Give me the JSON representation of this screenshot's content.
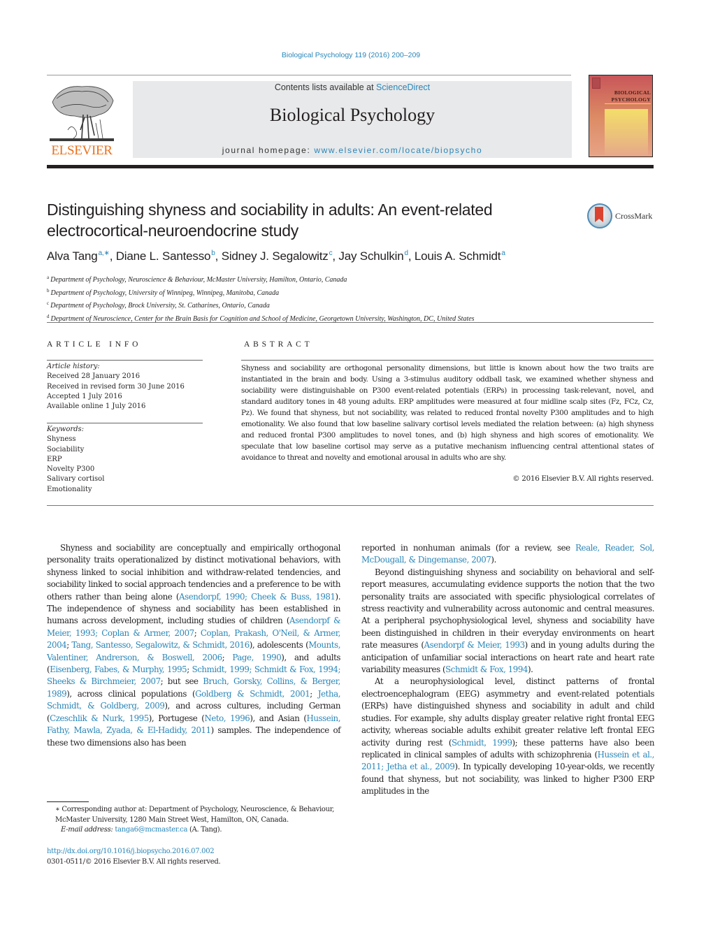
{
  "header": {
    "citation": "Biological Psychology 119 (2016) 200–209",
    "publisher": "ELSEVIER",
    "contents_prefix": "Contents lists available at ",
    "contents_link": "ScienceDirect",
    "journal_name": "Biological Psychology",
    "homepage_prefix": "journal homepage: ",
    "homepage_link": "www.elsevier.com/locate/biopsycho",
    "cover_title_line1": "BIOLOGICAL",
    "cover_title_line2": "PSYCHOLOGY",
    "colors": {
      "link": "#2a86b8",
      "elsevier_orange": "#e9711c",
      "masthead_bg": "#e8e9ea"
    }
  },
  "article": {
    "title": "Distinguishing shyness and sociability in adults: An event-related electrocortical-neuroendocrine study",
    "crossmark_label": "CrossMark",
    "authors": [
      {
        "name": "Alva Tang",
        "sup": "a,∗"
      },
      {
        "name": "Diane L. Santesso",
        "sup": "b"
      },
      {
        "name": "Sidney J. Segalowitz",
        "sup": "c"
      },
      {
        "name": "Jay Schulkin",
        "sup": "d"
      },
      {
        "name": "Louis A. Schmidt",
        "sup": "a"
      }
    ],
    "affiliations": [
      {
        "key": "a",
        "text": "Department of Psychology, Neuroscience & Behaviour, McMaster University, Hamilton, Ontario, Canada"
      },
      {
        "key": "b",
        "text": "Department of Psychology, University of Winnipeg, Winnipeg, Manitoba, Canada"
      },
      {
        "key": "c",
        "text": "Department of Psychology, Brock University, St. Catharines, Ontario, Canada"
      },
      {
        "key": "d",
        "text": "Department of Neuroscience, Center for the Brain Basis for Cognition and School of Medicine, Georgetown University, Washington, DC, United States"
      }
    ]
  },
  "article_info": {
    "heading": "ARTICLE INFO",
    "history_label": "Article history:",
    "history": [
      "Received 28 January 2016",
      "Received in revised form 30 June 2016",
      "Accepted 1 July 2016",
      "Available online 1 July 2016"
    ],
    "keywords_label": "Keywords:",
    "keywords": [
      "Shyness",
      "Sociability",
      "ERP",
      "Novelty P300",
      "Salivary cortisol",
      "Emotionality"
    ]
  },
  "abstract": {
    "heading": "ABSTRACT",
    "text": "Shyness and sociability are orthogonal personality dimensions, but little is known about how the two traits are instantiated in the brain and body. Using a 3-stimulus auditory oddball task, we examined whether shyness and sociability were distinguishable on P300 event-related potentials (ERPs) in processing task-relevant, novel, and standard auditory tones in 48 young adults. ERP amplitudes were measured at four midline scalp sites (Fz, FCz, Cz, Pz). We found that shyness, but not sociability, was related to reduced frontal novelty P300 amplitudes and to high emotionality. We also found that low baseline salivary cortisol levels mediated the relation between: (a) high shyness and reduced frontal P300 amplitudes to novel tones, and (b) high shyness and high scores of emotionality. We speculate that low baseline cortisol may serve as a putative mechanism influencing central attentional states of avoidance to threat and novelty and emotional arousal in adults who are shy.",
    "copyright": "© 2016 Elsevier B.V. All rights reserved."
  },
  "body": {
    "left_paragraphs": [
      [
        {
          "t": "Shyness and sociability are conceptually and empirically orthogonal personality traits operationalized by distinct motivational behaviors, with shyness linked to social inhibition and withdraw-related tendencies, and sociability linked to social approach tendencies and a preference to be with others rather than being alone ("
        },
        {
          "t": "Asendorpf, 1990; Cheek & Buss, 1981",
          "link": true
        },
        {
          "t": "). The independence of shyness and sociability has been established in humans across development, including studies of children ("
        },
        {
          "t": "Asendorpf & Meier, 1993; Coplan & Armer, 2007",
          "link": true
        },
        {
          "t": "; "
        },
        {
          "t": "Coplan, Prakash, O'Neil, & Armer, 2004",
          "link": true
        },
        {
          "t": "; "
        },
        {
          "t": "Tang, Santesso, Segalowitz, & Schmidt, 2016",
          "link": true
        },
        {
          "t": "), adolescents ("
        },
        {
          "t": "Mounts, Valentiner, Andrerson, & Boswell, 2006",
          "link": true
        },
        {
          "t": "; "
        },
        {
          "t": "Page, 1990",
          "link": true
        },
        {
          "t": "), and adults ("
        },
        {
          "t": "Eisenberg, Fabes, & Murphy, 1995",
          "link": true
        },
        {
          "t": "; "
        },
        {
          "t": "Schmidt, 1999; Schmidt & Fox, 1994; Sheeks & Birchmeier, 2007",
          "link": true
        },
        {
          "t": "; but see "
        },
        {
          "t": "Bruch, Gorsky, Collins, & Berger, 1989",
          "link": true
        },
        {
          "t": "), across clinical populations ("
        },
        {
          "t": "Goldberg & Schmidt, 2001",
          "link": true
        },
        {
          "t": "; "
        },
        {
          "t": "Jetha, Schmidt, & Goldberg, 2009",
          "link": true
        },
        {
          "t": "), and across cultures, including German ("
        },
        {
          "t": "Czeschlik & Nurk, 1995",
          "link": true
        },
        {
          "t": "), Portugese ("
        },
        {
          "t": "Neto, 1996",
          "link": true
        },
        {
          "t": "), and Asian ("
        },
        {
          "t": "Hussein, Fathy, Mawla, Zyada, & El-Hadidy, 2011",
          "link": true
        },
        {
          "t": ") samples. The independence of these two dimensions also has been"
        }
      ]
    ],
    "right_paragraphs": [
      [
        {
          "t": "reported in nonhuman animals (for a review, see "
        },
        {
          "t": "Reale, Reader, Sol, McDougall, & Dingemanse, 2007",
          "link": true
        },
        {
          "t": ")."
        }
      ],
      [
        {
          "t": "Beyond distinguishing shyness and sociability on behavioral and self-report measures, accumulating evidence supports the notion that the two personality traits are associated with specific physiological correlates of stress reactivity and vulnerability across autonomic and central measures. At a peripheral psychophysiological level, shyness and sociability have been distinguished in children in their everyday environments on heart rate measures ("
        },
        {
          "t": "Asendorpf & Meier, 1993",
          "link": true
        },
        {
          "t": ") and in young adults during the anticipation of unfamiliar social interactions on heart rate and heart rate variability measures ("
        },
        {
          "t": "Schmidt & Fox, 1994",
          "link": true
        },
        {
          "t": ")."
        }
      ],
      [
        {
          "t": "At a neurophysiological level, distinct patterns of frontal electroencephalogram (EEG) asymmetry and event-related potentials (ERPs) have distinguished shyness and sociability in adult and child studies. For example, shy adults display greater relative right frontal EEG activity, whereas sociable adults exhibit greater relative left frontal EEG activity during rest ("
        },
        {
          "t": "Schmidt, 1999",
          "link": true
        },
        {
          "t": "); these patterns have also been replicated in clinical samples of adults with schizophrenia ("
        },
        {
          "t": "Hussein et al., 2011; Jetha et al., 2009",
          "link": true
        },
        {
          "t": "). In typically developing 10-year-olds, we recently found that shyness, but not sociability, was linked to higher P300 ERP amplitudes in the"
        }
      ]
    ]
  },
  "footnote": {
    "marker": "∗",
    "corresponding": "Corresponding author at: Department of Psychology, Neuroscience, & Behaviour, McMaster University, 1280 Main Street West, Hamilton, ON, Canada.",
    "email_label": "E-mail address:",
    "email": "tanga6@mcmaster.ca",
    "email_suffix": " (A. Tang).",
    "doi": "http://dx.doi.org/10.1016/j.biopsycho.2016.07.002",
    "issn_copyright": "0301-0511/© 2016 Elsevier B.V. All rights reserved."
  }
}
